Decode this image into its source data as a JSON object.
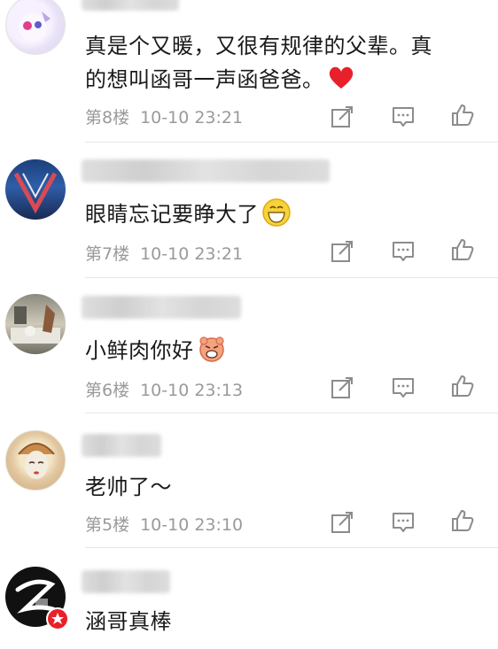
{
  "comments": [
    {
      "text_line1": "真是个又暖，又很有规律的父辈。真",
      "text_line2": "的想叫函哥一声函爸爸。",
      "floor": "第8楼",
      "time": "10-10 23:21",
      "emoji_icon": "red-heart-icon"
    },
    {
      "text_line1": "眼睛忘记要睁大了",
      "floor": "第7楼",
      "time": "10-10 23:21",
      "emoji_icon": "grinning-face-icon"
    },
    {
      "text_line1": "小鲜肉你好",
      "floor": "第6楼",
      "time": "10-10 23:13",
      "emoji_icon": "angry-pig-icon"
    },
    {
      "text_line1": "老帅了～",
      "floor": "第5楼",
      "time": "10-10 23:10"
    },
    {
      "text_line1": "涵哥真棒"
    }
  ],
  "icons": {
    "share": "share-icon",
    "comment": "comment-icon",
    "like": "thumbs-up-icon"
  },
  "colors": {
    "meta_text": "#9a9a9a",
    "heart": "#e8202a",
    "vip_badge": "#e8202a"
  }
}
